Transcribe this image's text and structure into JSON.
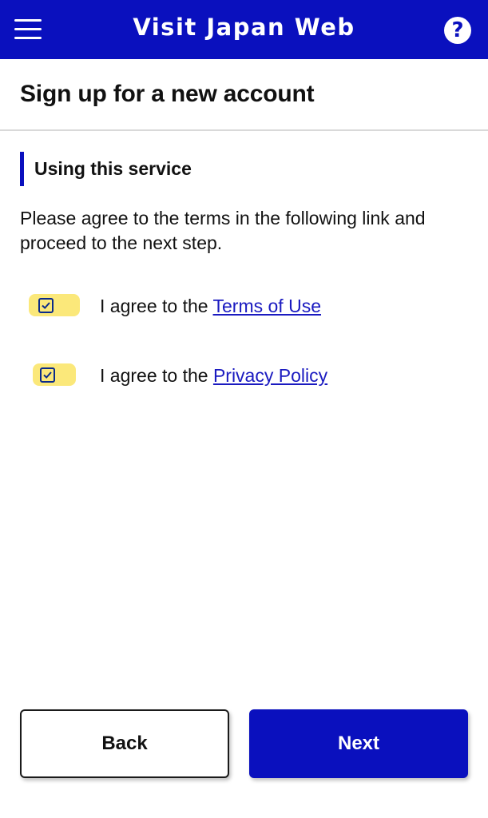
{
  "header": {
    "title": "Visit Japan Web",
    "menu_icon": "hamburger-menu-icon",
    "help_icon": "question-circle-icon",
    "help_glyph": "?",
    "color": "#0a10be"
  },
  "page": {
    "title": "Sign up for a new account"
  },
  "section": {
    "heading": "Using this service",
    "intro": "Please agree to the terms in the following link and proceed to the next step."
  },
  "agreements": [
    {
      "prefix": "I agree to the ",
      "link_text": "Terms of Use",
      "checked": true
    },
    {
      "prefix": "I agree to the ",
      "link_text": "Privacy Policy",
      "checked": true
    }
  ],
  "buttons": {
    "back_label": "Back",
    "next_label": "Next"
  },
  "colors": {
    "accent": "#0a10be",
    "link": "#1a1ac0",
    "highlight": "#fbe56b"
  }
}
